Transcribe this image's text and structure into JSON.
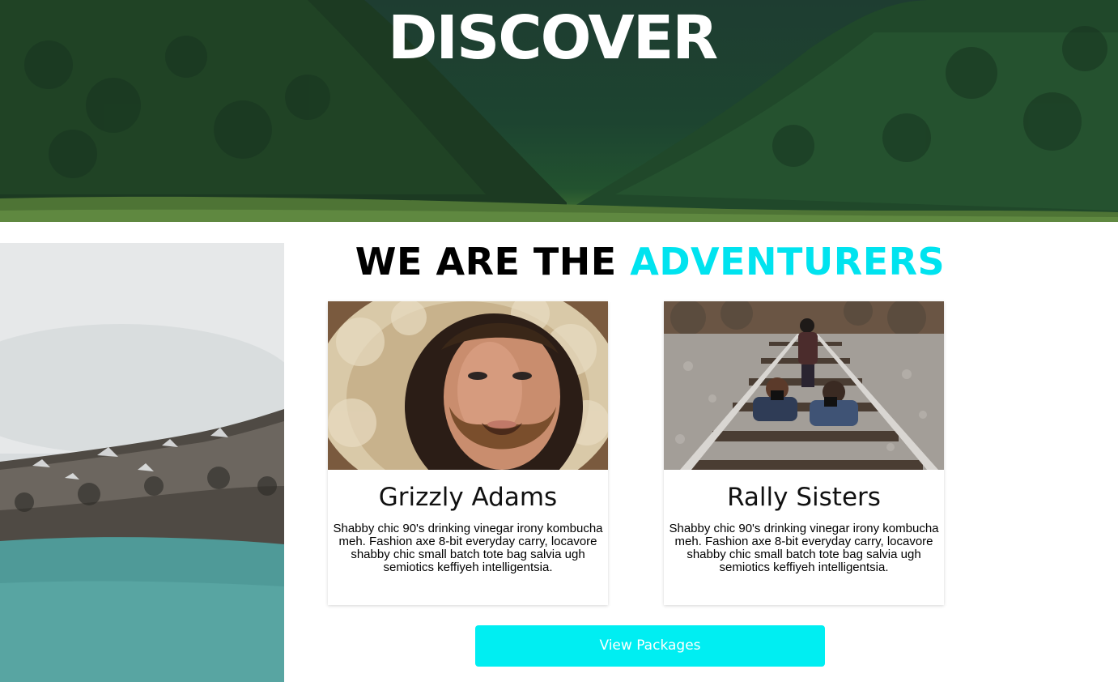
{
  "hero": {
    "title": "DISCOVER"
  },
  "section": {
    "title_part1": "WE ARE THE ",
    "title_part2": "ADVENTURERS",
    "accent_color": "#00e3ef"
  },
  "cards": [
    {
      "name": "Grizzly Adams",
      "description": "Shabby chic 90's drinking vinegar irony kombucha meh. Fashion axe 8-bit everyday carry, locavore shabby chic small batch tote bag salvia ugh semiotics keffiyeh intelligentsia."
    },
    {
      "name": "Rally Sisters",
      "description": "Shabby chic 90's drinking vinegar irony kombucha meh. Fashion axe 8-bit everyday carry, locavore shabby chic small batch tote bag salvia ugh semiotics keffiyeh intelligentsia."
    }
  ],
  "cta": {
    "label": "View Packages",
    "color": "#00eef2"
  }
}
